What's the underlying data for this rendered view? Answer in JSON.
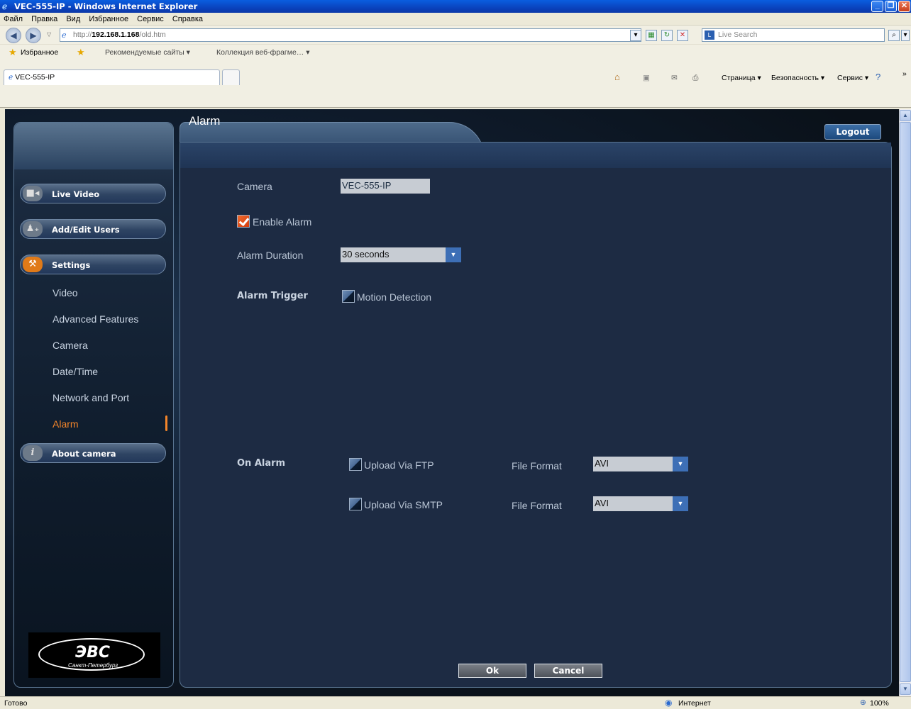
{
  "browser": {
    "title": "VEC-555-IP - Windows Internet Explorer",
    "menu": [
      "Файл",
      "Правка",
      "Вид",
      "Избранное",
      "Сервис",
      "Справка"
    ],
    "url_prefix": "http://",
    "url_host": "192.168.1.168",
    "url_path": "/old.htm",
    "search_placeholder": "Live Search",
    "favorites_label": "Избранное",
    "favorites_links": [
      "Рекомендуемые сайты ▾",
      "Коллекция веб-фрагме… ▾"
    ],
    "tab_title": "VEC-555-IP",
    "command_items": [
      "Страница ▾",
      "Безопасность ▾",
      "Сервис ▾"
    ],
    "status_text": "Готово",
    "zone_text": "Интернет",
    "zoom_text": "100%"
  },
  "sidebar": {
    "menu": [
      {
        "label": "Live Video",
        "icon": "video-camera-icon"
      },
      {
        "label": "Add/Edit Users",
        "icon": "add-user-icon"
      },
      {
        "label": "Settings",
        "icon": "tools-icon"
      },
      {
        "label": "About camera",
        "icon": "info-icon"
      }
    ],
    "settings_items": [
      "Video",
      "Advanced Features",
      "Camera",
      "Date/Time",
      "Network and Port",
      "Alarm"
    ],
    "active_item": "Alarm",
    "logo_brand": "ЭВС",
    "logo_city": "Санкт-Петербург"
  },
  "page": {
    "title": "Alarm",
    "logout_label": "Logout",
    "camera_label": "Camera",
    "camera_value": "VEC-555-IP",
    "enable_alarm_label": "Enable Alarm",
    "enable_alarm_checked": true,
    "alarm_duration_label": "Alarm Duration",
    "alarm_duration_value": "30 seconds",
    "alarm_trigger_label": "Alarm Trigger",
    "motion_detection_label": "Motion Detection",
    "motion_detection_checked": false,
    "on_alarm_label": "On Alarm",
    "upload_ftp_label": "Upload Via FTP",
    "upload_ftp_checked": false,
    "upload_smtp_label": "Upload Via SMTP",
    "upload_smtp_checked": false,
    "file_format_label": "File Format",
    "ftp_file_format": "AVI",
    "smtp_file_format": "AVI",
    "ok_label": "Ok",
    "cancel_label": "Cancel"
  },
  "colors": {
    "accent": "#f3852a",
    "panel_bg": "#1d2b43",
    "select_arrow": "#3d6fb6"
  }
}
